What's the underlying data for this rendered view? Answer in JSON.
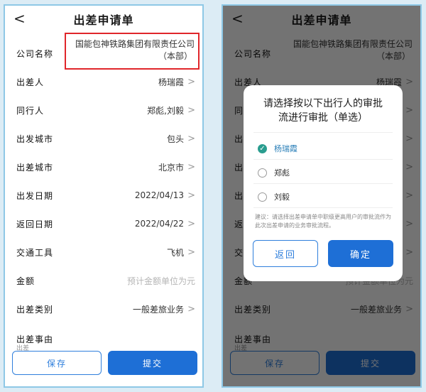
{
  "form": {
    "title": "出差申请单",
    "back_glyph": "<",
    "arrow_glyph": ">",
    "company": {
      "label": "公司名称",
      "value_line1": "国能包神铁路集团有限责任公司",
      "value_line2": "（本部）"
    },
    "fields": [
      {
        "label": "出差人",
        "value": "杨瑞霞"
      },
      {
        "label": "同行人",
        "value": "郑彪,刘毅"
      },
      {
        "label": "出发城市",
        "value": "包头"
      },
      {
        "label": "出差城市",
        "value": "北京市"
      },
      {
        "label": "出发日期",
        "value": "2022/04/13"
      },
      {
        "label": "返回日期",
        "value": "2022/04/22"
      },
      {
        "label": "交通工具",
        "value": "飞机"
      },
      {
        "label": "金额",
        "placeholder": "预计金额单位为元"
      },
      {
        "label": "出差类别",
        "value": "一般差旅业务"
      },
      {
        "label": "出差事由",
        "value": ""
      }
    ],
    "cut_label": "出差",
    "save_label": "保存",
    "submit_label": "提交"
  },
  "dialog": {
    "title": "请选择按以下出行人的审批流进行审批（单选）",
    "options": [
      {
        "name": "杨瑞霞",
        "checked": true
      },
      {
        "name": "郑彪",
        "checked": false
      },
      {
        "name": "刘毅",
        "checked": false
      }
    ],
    "check_glyph": "✓",
    "note": "建议：请选择出差申请单中职级更高用户的审批流作为此次出差申请的业务审批流程。",
    "back_label": "返回",
    "confirm_label": "确定"
  },
  "colors": {
    "accent": "#1e6fd6",
    "highlight_border": "#e0262b",
    "check": "#2a9d8f",
    "frame": "#8ec8e6"
  }
}
